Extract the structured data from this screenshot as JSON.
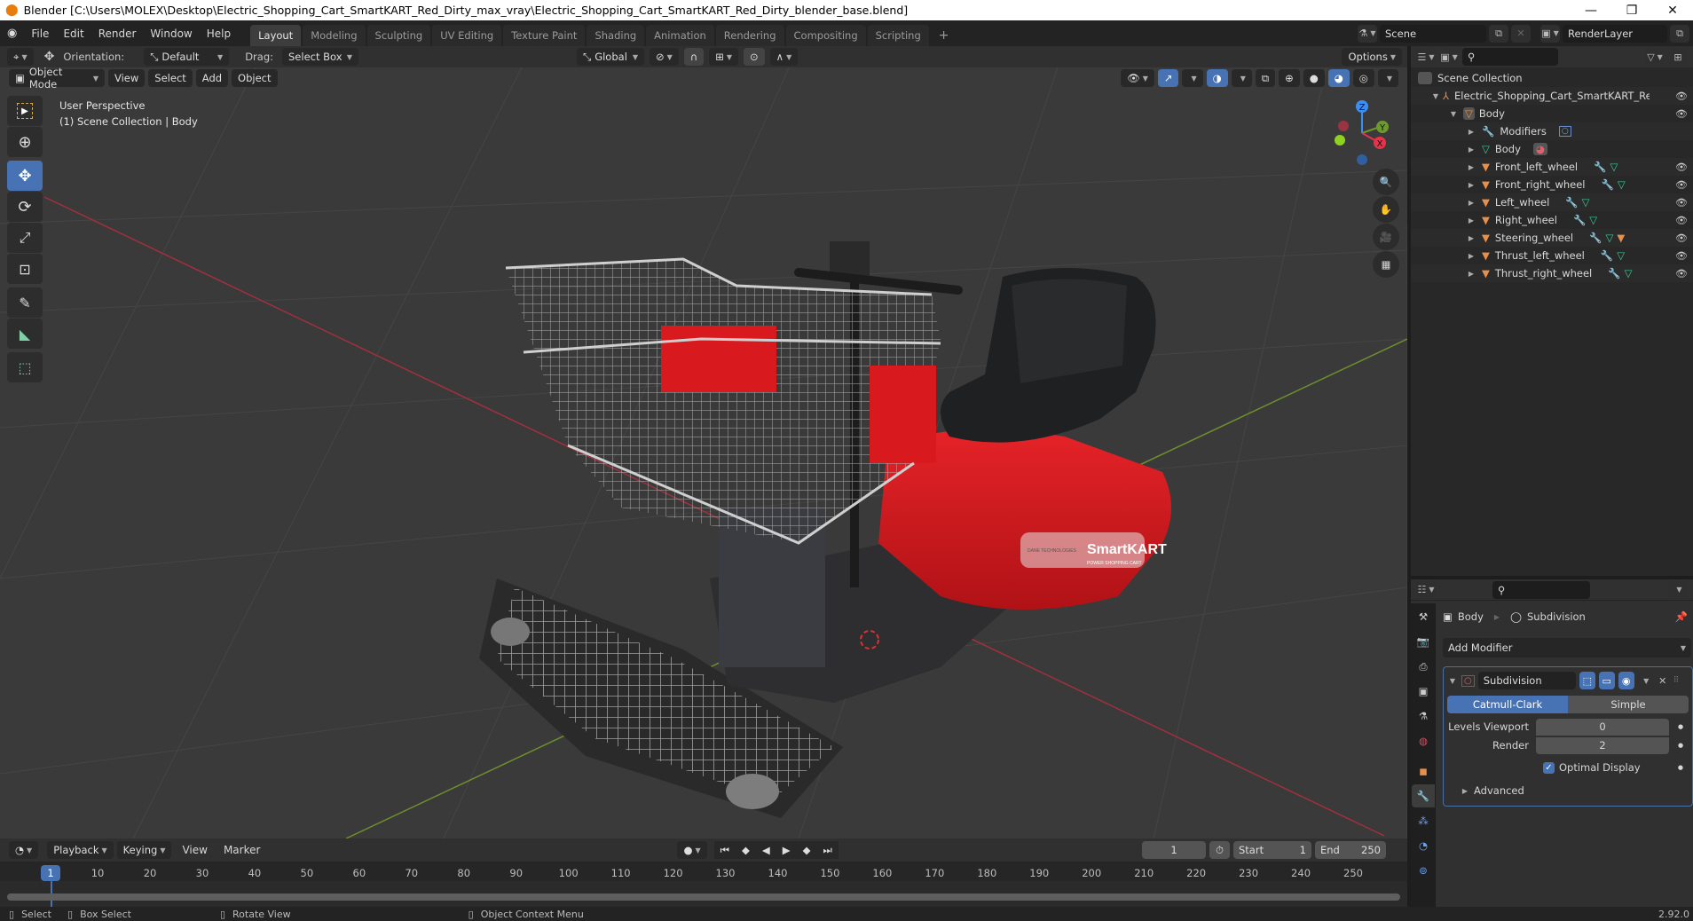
{
  "window": {
    "title": "Blender [C:\\Users\\MOLEX\\Desktop\\Electric_Shopping_Cart_SmartKART_Red_Dirty_max_vray\\Electric_Shopping_Cart_SmartKART_Red_Dirty_blender_base.blend]",
    "controls": {
      "minimize": "—",
      "maximize": "❐",
      "close": "✕"
    }
  },
  "topbar": {
    "menus": [
      "File",
      "Edit",
      "Render",
      "Window",
      "Help"
    ],
    "workspaces": [
      "Layout",
      "Modeling",
      "Sculpting",
      "UV Editing",
      "Texture Paint",
      "Shading",
      "Animation",
      "Rendering",
      "Compositing",
      "Scripting"
    ],
    "active_workspace": "Layout",
    "add_workspace": "+",
    "scene_name": "Scene",
    "view_layer": "RenderLayer"
  },
  "viewport_header": {
    "orientation_label": "Orientation:",
    "orientation_value": "Default",
    "drag_label": "Drag:",
    "drag_value": "Select Box",
    "transform_orientation": "Global",
    "options_label": "Options",
    "mode": "Object Mode",
    "menus": [
      "View",
      "Select",
      "Add",
      "Object"
    ]
  },
  "viewport": {
    "perspective_label": "User Perspective",
    "collection_label": "(1) Scene Collection | Body",
    "gizmo_axes": {
      "x": "X",
      "y": "Y",
      "z": "Z"
    },
    "colors": {
      "x_axis": "#e8324a",
      "y_axis": "#6d9a2c",
      "z_axis": "#3a8ff5",
      "grid_bg": "#3a3a3a",
      "cart_red": "#d8191c"
    },
    "decal_brand": "SmartKART",
    "decal_sub": "POWER SHOPPING CART",
    "decal_logo": "DANE TECHNOLOGIES"
  },
  "outliner": {
    "root": "Scene Collection",
    "collection": "Electric_Shopping_Cart_SmartKART_Red_Dir",
    "items": [
      {
        "name": "Body",
        "level": 1,
        "type": "object",
        "expanded": true
      },
      {
        "name": "Modifiers",
        "level": 2,
        "type": "modifiers"
      },
      {
        "name": "Body",
        "level": 2,
        "type": "mesh"
      },
      {
        "name": "Front_left_wheel",
        "level": 2,
        "type": "object"
      },
      {
        "name": "Front_right_wheel",
        "level": 2,
        "type": "object"
      },
      {
        "name": "Left_wheel",
        "level": 2,
        "type": "object"
      },
      {
        "name": "Right_wheel",
        "level": 2,
        "type": "object"
      },
      {
        "name": "Steering_wheel",
        "level": 2,
        "type": "object"
      },
      {
        "name": "Thrust_left_wheel",
        "level": 2,
        "type": "object"
      },
      {
        "name": "Thrust_right_wheel",
        "level": 2,
        "type": "object"
      }
    ]
  },
  "properties": {
    "breadcrumb_object": "Body",
    "breadcrumb_modifier": "Subdivision",
    "add_modifier": "Add Modifier",
    "modifier": {
      "name": "Subdivision",
      "type_options": [
        "Catmull-Clark",
        "Simple"
      ],
      "selected_type": "Catmull-Clark",
      "levels_viewport_label": "Levels Viewport",
      "levels_viewport": "0",
      "render_label": "Render",
      "render": "2",
      "optimal_display_label": "Optimal Display",
      "optimal_display": true,
      "advanced_label": "Advanced"
    }
  },
  "timeline": {
    "menus": [
      "Playback",
      "Keying",
      "View",
      "Marker"
    ],
    "current_frame": "1",
    "start_label": "Start",
    "start": "1",
    "end_label": "End",
    "end": "250",
    "ticks": [
      "10",
      "20",
      "30",
      "40",
      "50",
      "60",
      "70",
      "80",
      "90",
      "100",
      "110",
      "120",
      "130",
      "140",
      "150",
      "160",
      "170",
      "180",
      "190",
      "200",
      "210",
      "220",
      "230",
      "240",
      "250"
    ],
    "playhead": "1"
  },
  "statusbar": {
    "hints": [
      "Select",
      "Box Select",
      "Rotate View",
      "Object Context Menu"
    ],
    "version": "2.92.0"
  }
}
